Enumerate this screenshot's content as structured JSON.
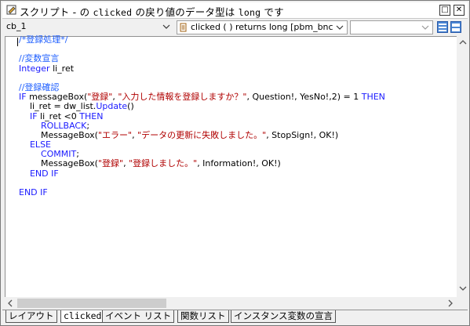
{
  "window": {
    "title_prefix": "スクリプト - ",
    "title_object": "",
    "title_event": "clicked",
    "title_middle": "の戻り値のデータ型は",
    "title_type": "long",
    "title_suffix": "です",
    "btn_restore": "□",
    "btn_close": "✕"
  },
  "toolbar": {
    "object_combo": "cb_1",
    "event_combo": "clicked ( ) returns long [pbm_bnclic",
    "third_combo": "",
    "object_icon": "chevron-down-icon",
    "event_icon": "script-event-icon"
  },
  "code_lines": [
    [
      {
        "c": "cm",
        "t": "/*登録処理*/"
      }
    ],
    [
      {
        "c": "pl",
        "t": ""
      }
    ],
    [
      {
        "c": "cm",
        "t": "//変数宣言"
      }
    ],
    [
      {
        "c": "kw",
        "t": "Integer"
      },
      {
        "c": "pl",
        "t": " li_ret"
      }
    ],
    [
      {
        "c": "pl",
        "t": ""
      }
    ],
    [
      {
        "c": "cm",
        "t": "//登録確認"
      }
    ],
    [
      {
        "c": "kw",
        "t": "IF"
      },
      {
        "c": "pl",
        "t": " messageBox("
      },
      {
        "c": "str",
        "t": "\"登録\""
      },
      {
        "c": "pl",
        "t": ", "
      },
      {
        "c": "str",
        "t": "\"入力した情報を登録しますか？\""
      },
      {
        "c": "pl",
        "t": ", Question!, YesNo!,2) = 1 "
      },
      {
        "c": "kw",
        "t": "THEN"
      }
    ],
    [
      {
        "c": "pl",
        "t": "    li_ret = dw_list."
      },
      {
        "c": "kw",
        "t": "Update"
      },
      {
        "c": "pl",
        "t": "()"
      }
    ],
    [
      {
        "c": "kw",
        "t": "    IF"
      },
      {
        "c": "pl",
        "t": " li_ret <0 "
      },
      {
        "c": "kw",
        "t": "THEN"
      }
    ],
    [
      {
        "c": "kw",
        "t": "        ROLLBACK"
      },
      {
        "c": "pl",
        "t": ";"
      }
    ],
    [
      {
        "c": "pl",
        "t": "        MessageBox("
      },
      {
        "c": "str",
        "t": "\"エラー\""
      },
      {
        "c": "pl",
        "t": ", "
      },
      {
        "c": "str",
        "t": "\"データの更新に失敗しました。\""
      },
      {
        "c": "pl",
        "t": ", StopSign!, OK!)"
      }
    ],
    [
      {
        "c": "kw",
        "t": "    ELSE"
      }
    ],
    [
      {
        "c": "kw",
        "t": "        COMMIT"
      },
      {
        "c": "pl",
        "t": ";"
      }
    ],
    [
      {
        "c": "pl",
        "t": "        MessageBox("
      },
      {
        "c": "str",
        "t": "\"登録\""
      },
      {
        "c": "pl",
        "t": ", "
      },
      {
        "c": "str",
        "t": "\"登録しました。\""
      },
      {
        "c": "pl",
        "t": ", Information!, OK!)"
      }
    ],
    [
      {
        "c": "kw",
        "t": "    END IF"
      }
    ],
    [
      {
        "c": "pl",
        "t": ""
      }
    ],
    [
      {
        "c": "kw",
        "t": "END IF"
      }
    ]
  ],
  "tabs": [
    {
      "label": "レイアウト",
      "active": false
    },
    {
      "label": "clicked",
      "active": true
    },
    {
      "label": "イベント リスト",
      "active": false
    },
    {
      "label": "関数リスト",
      "active": false
    },
    {
      "label": "インスタンス変数の宣言",
      "active": false
    }
  ],
  "colors": {
    "keyword": "#1a1aff",
    "comment": "#2060ff",
    "string": "#b00000"
  }
}
